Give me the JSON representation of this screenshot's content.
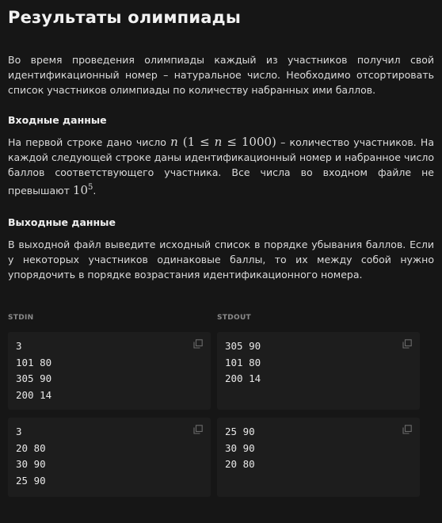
{
  "problem": {
    "title": "Результаты олимпиады",
    "statement": "Во время проведения олимпиады каждый из участников получил свой идентификационный номер – натуральное число. Необходимо отсортировать список участников олимпиады по количеству набранных ими баллов.",
    "input": {
      "heading": "Входные данные",
      "text_before": "На первой строке дано число ",
      "math_n": "n",
      "math_range_open": " (1 ≤ ",
      "math_range_n": "n",
      "math_range_close": " ≤ 1000)",
      "text_middle": " – количество участников. На каждой следующей строке даны идентификационный номер и набранное число баллов соответствующего участника. Все числа во входном файле не превышают ",
      "math_base": "10",
      "math_exp": "5",
      "text_end": "."
    },
    "output": {
      "heading": "Выходные данные",
      "text": "В выходной файл выведите исходный список в порядке убывания баллов. Если у некоторых участников одинаковые баллы, то их между собой нужно упорядочить в порядке возрастания идентификационного номера."
    }
  },
  "samples": {
    "stdin_label": "STDIN",
    "stdout_label": "STDOUT",
    "copy_icon": "copy-icon",
    "tests": [
      {
        "stdin": "3\n101 80\n305 90\n200 14",
        "stdout": "305 90\n101 80\n200 14"
      },
      {
        "stdin": "3\n20 80\n30 90\n25 90",
        "stdout": "25 90\n30 90\n20 80"
      }
    ]
  }
}
